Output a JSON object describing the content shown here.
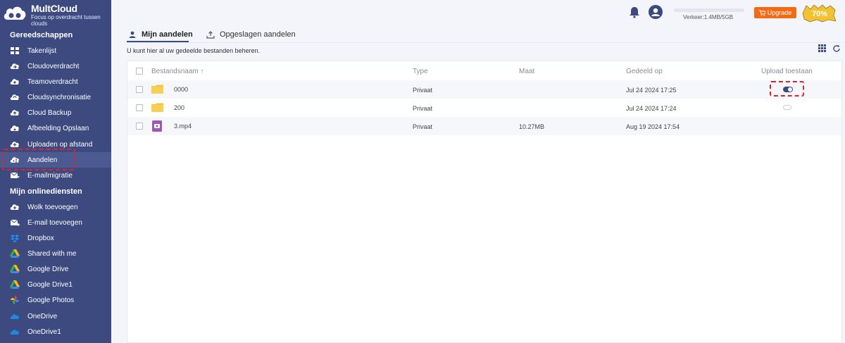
{
  "brand": {
    "name": "MultCloud",
    "tagline": "Focus op overdracht tussen clouds"
  },
  "sidebar": {
    "tools_title": "Gereedschappen",
    "tools": [
      {
        "label": "Takenlijst",
        "icon": "tasklist-icon"
      },
      {
        "label": "Cloudoverdracht",
        "icon": "cloud-transfer-icon"
      },
      {
        "label": "Teamoverdracht",
        "icon": "team-transfer-icon"
      },
      {
        "label": "Cloudsynchronisatie",
        "icon": "cloud-sync-icon"
      },
      {
        "label": "Cloud Backup",
        "icon": "cloud-backup-icon"
      },
      {
        "label": "Afbeelding Opslaan",
        "icon": "image-save-icon"
      },
      {
        "label": "Uploaden op afstand",
        "icon": "remote-upload-icon"
      },
      {
        "label": "Aandelen",
        "icon": "share-icon"
      },
      {
        "label": "E-mailmigratie",
        "icon": "email-migration-icon"
      }
    ],
    "services_title": "Mijn onlinediensten",
    "services": [
      {
        "label": "Wolk toevoegen",
        "icon": "add-cloud-icon"
      },
      {
        "label": "E-mail toevoegen",
        "icon": "add-email-icon"
      },
      {
        "label": "Dropbox",
        "icon": "dropbox-icon"
      },
      {
        "label": "Shared with me",
        "icon": "google-drive-icon"
      },
      {
        "label": "Google Drive",
        "icon": "google-drive-icon"
      },
      {
        "label": "Google Drive1",
        "icon": "google-drive-icon"
      },
      {
        "label": "Google Photos",
        "icon": "google-photos-icon"
      },
      {
        "label": "OneDrive",
        "icon": "onedrive-icon"
      },
      {
        "label": "OneDrive1",
        "icon": "onedrive-icon"
      }
    ]
  },
  "topbar": {
    "traffic": "Verkeer:1.4MB/5GB",
    "upgrade": "Upgrade",
    "promo": "70%"
  },
  "tabs": [
    {
      "label": "Mijn aandelen",
      "active": true
    },
    {
      "label": "Opgeslagen aandelen",
      "active": false
    }
  ],
  "info": "U kunt hier al uw gedeelde bestanden beheren.",
  "table": {
    "columns": [
      "Bestandsnaam",
      "Type",
      "Maat",
      "Gedeeld op",
      "Upload toestaan"
    ],
    "sort_arrow": "↑",
    "rows": [
      {
        "name": "0000",
        "kind": "folder",
        "type": "Privaat",
        "size": "",
        "shared": "Jul 24 2024 17:25",
        "upload": "on"
      },
      {
        "name": "200",
        "kind": "folder",
        "type": "Privaat",
        "size": "",
        "shared": "Jul 24 2024 17:24",
        "upload": "off"
      },
      {
        "name": "3.mp4",
        "kind": "video",
        "type": "Privaat",
        "size": "10.27MB",
        "shared": "Aug 19 2024 17:54",
        "upload": ""
      }
    ]
  },
  "colors": {
    "sidebar": "#3d4a80",
    "accent": "#3d4a80",
    "upgrade": "#f46a14",
    "highlight": "#e0242a",
    "folder": "#f5c542",
    "video": "#9b59b6"
  }
}
